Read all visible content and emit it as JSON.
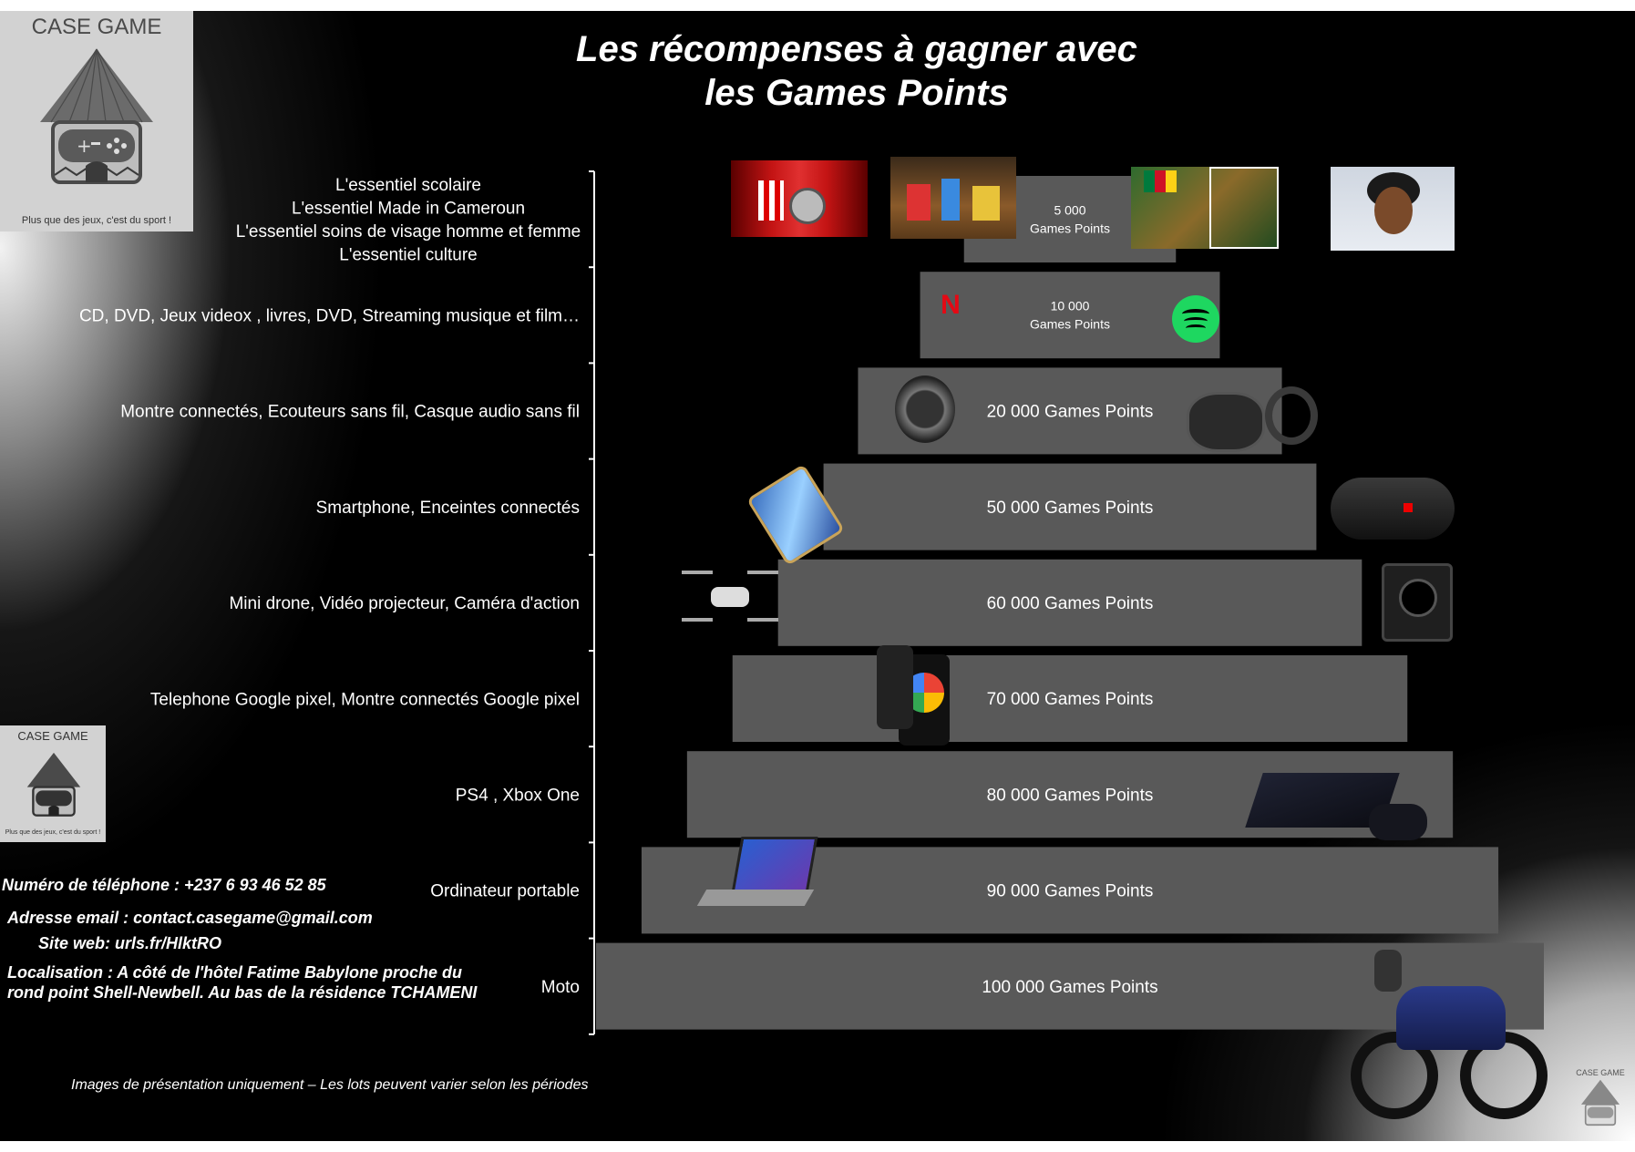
{
  "header": {
    "title_line1": "Les  récompenses à gagner avec",
    "title_line2": "les Games Points"
  },
  "logo_top": {
    "name": "CASE GAME",
    "tagline": "Plus que des jeux, c'est du sport !"
  },
  "logo_mid": {
    "name": "CASE GAME",
    "tagline": "Plus que des jeux, c'est du sport !"
  },
  "logo_corner": {
    "name": "CASE GAME"
  },
  "contact": {
    "phone": "Numéro de téléphone : +237 6 93 46 52 85",
    "email": "Adresse email : contact.casegame@gmail.com",
    "site": "Site web: urls.fr/HlktRO",
    "location_line1": "Localisation : A côté  de l'hôtel  Fatime Babylone proche du",
    "location_line2": "rond point Shell-Newbell. Au bas de la résidence TCHAMENI"
  },
  "footer_note": "Images de présentation uniquement – Les lots peuvent varier selon les périodes",
  "colors": {
    "background": "#000000",
    "bar": "#595959",
    "text": "#ffffff"
  },
  "chart_data": {
    "type": "bar",
    "orientation": "horizontal-centered (pyramid)",
    "categories": [
      [
        "L'essentiel scolaire",
        "L'essentiel Made in Cameroun",
        "L'essentiel soins de visage  homme et femme",
        "L'essentiel culture"
      ],
      [
        "CD, DVD, Jeux videox , livres, DVD, Streaming musique et film…"
      ],
      [
        "Montre connectés, Ecouteurs sans fil, Casque audio sans fil"
      ],
      [
        "Smartphone, Enceintes connectés"
      ],
      [
        "Mini drone, Vidéo projecteur, Caméra d'action"
      ],
      [
        "Telephone Google pixel, Montre connectés Google pixel"
      ],
      [
        "PS4 , Xbox One"
      ],
      [
        "Ordinateur portable"
      ],
      [
        "Moto"
      ]
    ],
    "values": [
      5000,
      10000,
      20000,
      50000,
      60000,
      70000,
      80000,
      90000,
      100000
    ],
    "bar_labels": [
      [
        "5 000",
        "Games Points"
      ],
      [
        "10 000",
        "Games Points"
      ],
      [
        "20 000 Games Points"
      ],
      [
        "50 000 Games Points"
      ],
      [
        "60 000 Games Points"
      ],
      [
        "70 000 Games Points"
      ],
      [
        "80 000 Games Points"
      ],
      [
        "90 000 Games Points"
      ],
      [
        "100 000 Games Points"
      ]
    ],
    "xlim": [
      0,
      100000
    ],
    "grid": false,
    "legend": "none"
  }
}
